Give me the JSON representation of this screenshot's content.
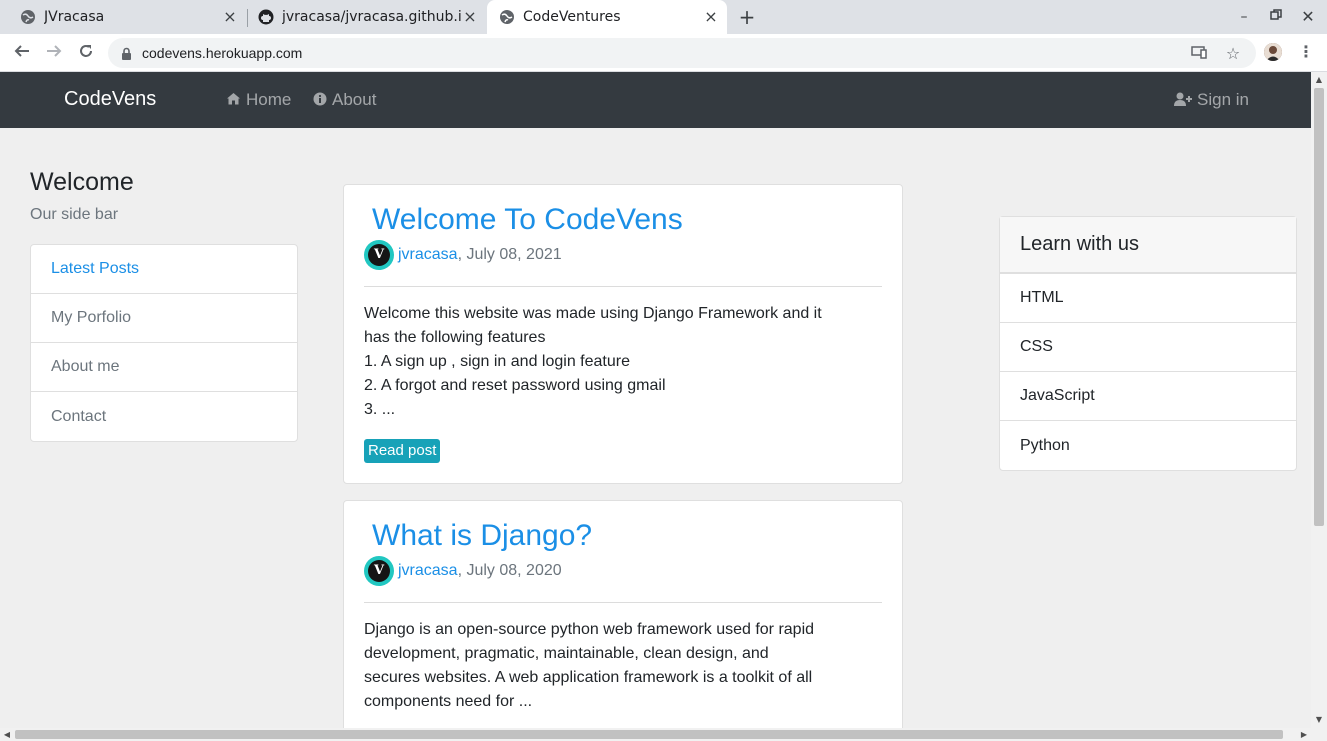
{
  "browser": {
    "tabs": [
      {
        "title": "JVracasa",
        "icon": "globe-icon"
      },
      {
        "title": "jvracasa/jvracasa.github.i",
        "icon": "github-icon"
      },
      {
        "title": "CodeVentures",
        "icon": "globe-icon"
      }
    ],
    "url": "codevens.herokuapp.com"
  },
  "navbar": {
    "brand": "CodeVens",
    "home": "Home",
    "about": "About",
    "signin": "Sign in"
  },
  "sidebar": {
    "heading": "Welcome",
    "subheading": "Our side bar",
    "items": [
      "Latest Posts",
      "My Porfolio",
      "About me",
      "Contact"
    ]
  },
  "posts": [
    {
      "title": "Welcome To CodeVens",
      "author": "jvracasa",
      "date": ", July 08, 2021",
      "lines": [
        "Welcome this website was made using Django Framework and it",
        "has the following features",
        "1. A sign up , sign in and login feature",
        "2. A forgot and reset password using gmail",
        "3. ..."
      ],
      "button": "Read post"
    },
    {
      "title": "What is Django?",
      "author": "jvracasa",
      "date": ", July 08, 2020",
      "lines": [
        "Django is an open-source python web framework used for rapid",
        "development, pragmatic, maintainable, clean design, and",
        "secures websites. A web application framework is a toolkit of all",
        "components need for ..."
      ]
    }
  ],
  "learn": {
    "heading": "Learn with us",
    "items": [
      "HTML",
      "CSS",
      "JavaScript",
      "Python"
    ]
  },
  "colors": {
    "navbar_bg": "#343a40",
    "link": "#1b8fe6",
    "button": "#17a2b8",
    "page_bg": "#efefef"
  }
}
